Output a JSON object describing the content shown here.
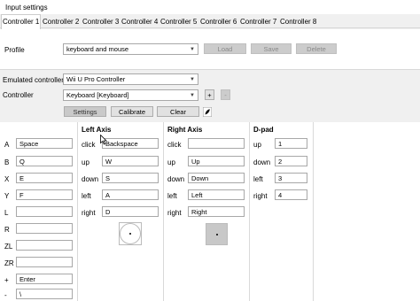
{
  "window": {
    "title": "Input settings"
  },
  "tabs": [
    {
      "label": "Controller 1"
    },
    {
      "label": "Controller 2"
    },
    {
      "label": "Controller 3"
    },
    {
      "label": "Controller 4"
    },
    {
      "label": "Controller 5"
    },
    {
      "label": "Controller 6"
    },
    {
      "label": "Controller 7"
    },
    {
      "label": "Controller 8"
    }
  ],
  "profile": {
    "label": "Profile",
    "value": "keyboard and mouse",
    "load": "Load",
    "save": "Save",
    "delete": "Delete"
  },
  "emulated": {
    "label": "Emulated controller",
    "value": "Wii U Pro Controller"
  },
  "controller": {
    "label": "Controller",
    "value": "Keyboard [Keyboard]",
    "add": "+",
    "remove": "-",
    "settings": "Settings",
    "calibrate": "Calibrate",
    "clear": "Clear"
  },
  "buttons": [
    {
      "label": "A",
      "value": "Space"
    },
    {
      "label": "B",
      "value": "Q"
    },
    {
      "label": "X",
      "value": "E"
    },
    {
      "label": "Y",
      "value": "F"
    },
    {
      "label": "L",
      "value": ""
    },
    {
      "label": "R",
      "value": ""
    },
    {
      "label": "ZL",
      "value": ""
    },
    {
      "label": "ZR",
      "value": ""
    },
    {
      "label": "+",
      "value": "Enter"
    },
    {
      "label": "-",
      "value": "\\"
    }
  ],
  "left_axis": {
    "title": "Left Axis",
    "rows": [
      {
        "label": "click",
        "value": "Backspace"
      },
      {
        "label": "up",
        "value": "W"
      },
      {
        "label": "down",
        "value": "S"
      },
      {
        "label": "left",
        "value": "A"
      },
      {
        "label": "right",
        "value": "D"
      }
    ]
  },
  "right_axis": {
    "title": "Right Axis",
    "rows": [
      {
        "label": "click",
        "value": ""
      },
      {
        "label": "up",
        "value": "Up"
      },
      {
        "label": "down",
        "value": "Down"
      },
      {
        "label": "left",
        "value": "Left"
      },
      {
        "label": "right",
        "value": "Right"
      }
    ]
  },
  "dpad": {
    "title": "D-pad",
    "rows": [
      {
        "label": "up",
        "value": "1"
      },
      {
        "label": "down",
        "value": "2"
      },
      {
        "label": "left",
        "value": "3"
      },
      {
        "label": "right",
        "value": "4"
      }
    ]
  }
}
